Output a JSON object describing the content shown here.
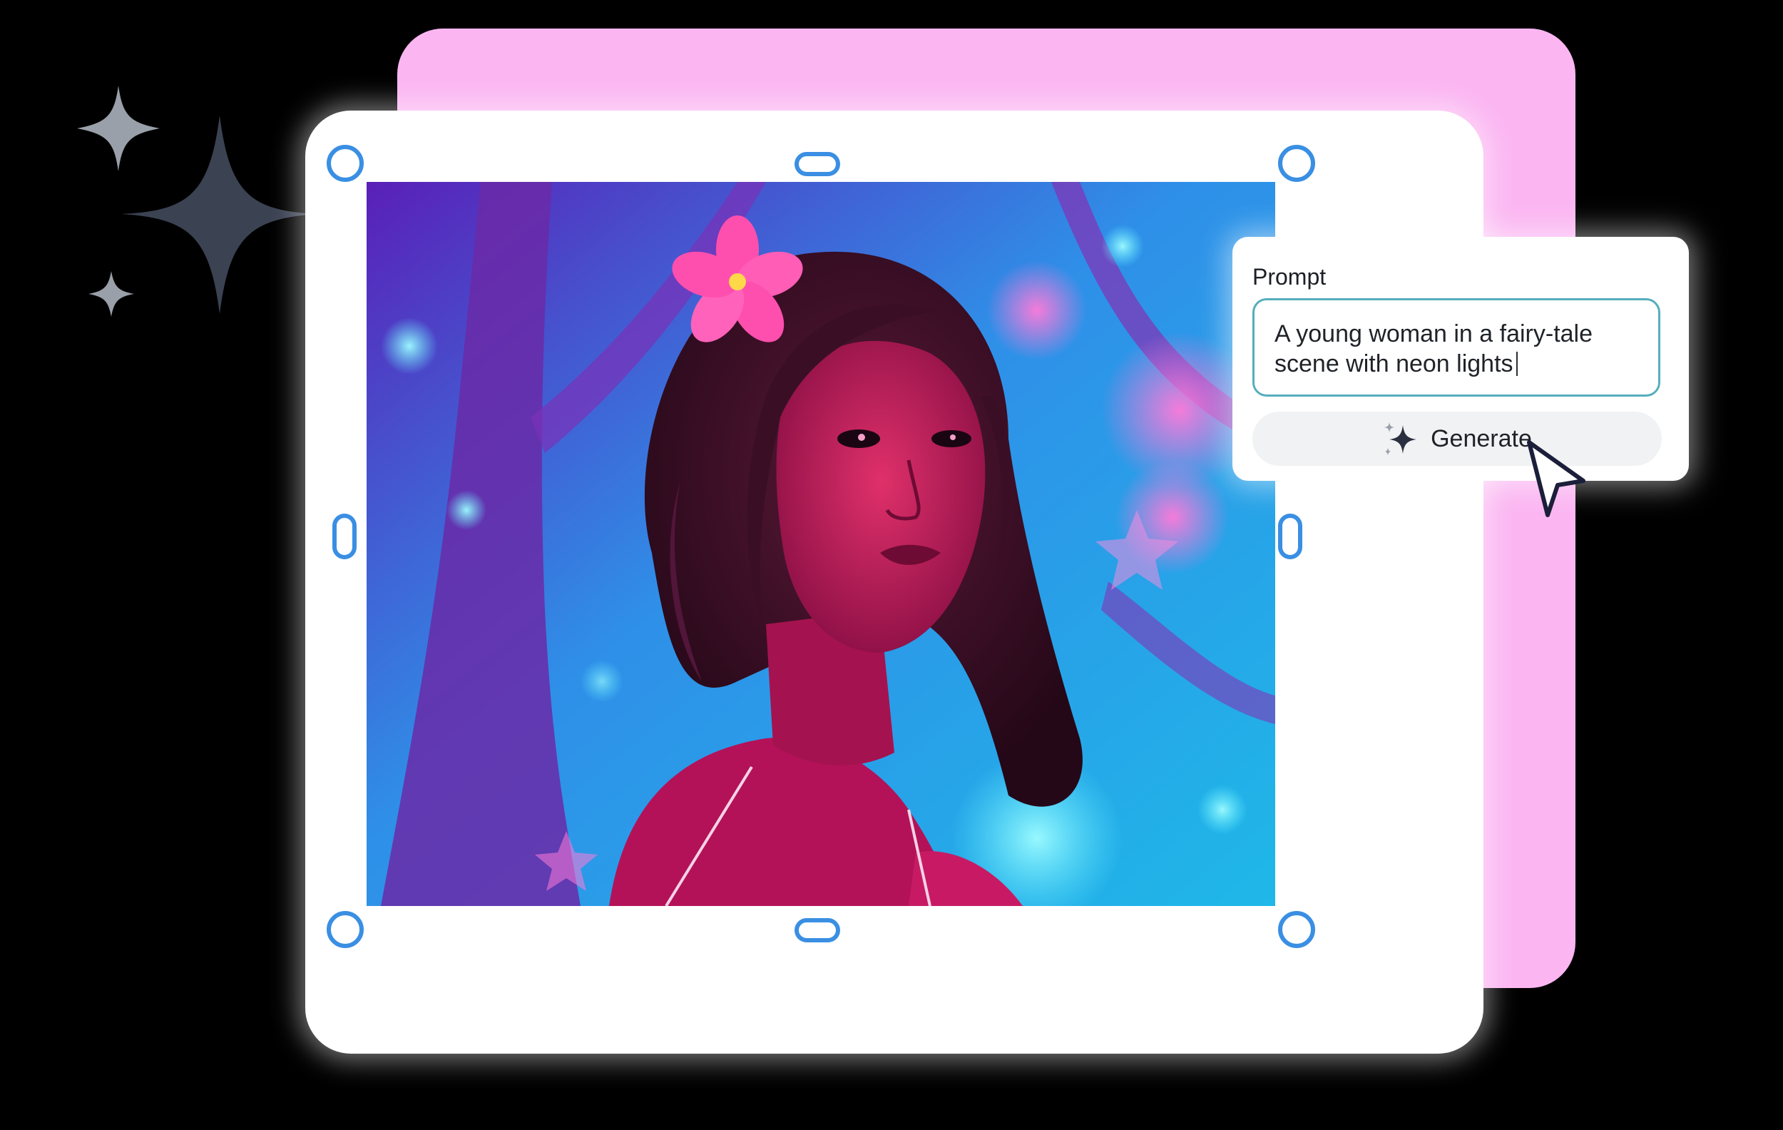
{
  "prompt_panel": {
    "label": "Prompt",
    "text_line1": "A young woman in a fairy-tale",
    "text_line2": "scene with neon lights",
    "generate_label": "Generate"
  },
  "icons": {
    "sparkles": "sparkle-icon",
    "generate": "sparkle-icon",
    "pointer": "mouse-pointer-icon"
  },
  "colors": {
    "background": "#000000",
    "pink_card": "#fbb6f2",
    "handle": "#3a8fe3",
    "field_border": "#56aebc"
  }
}
